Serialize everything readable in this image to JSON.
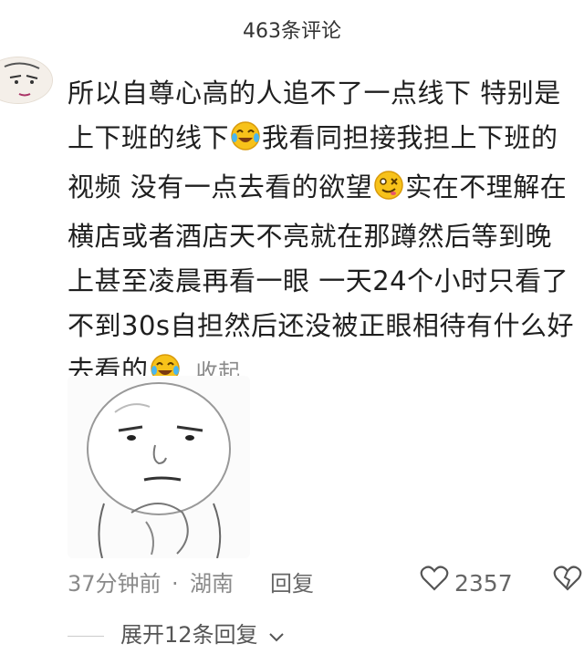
{
  "header": {
    "title": "463条评论"
  },
  "comment": {
    "lines": [
      "所以自尊心高的人追不了一点线下 特别是",
      "上下班的线下",
      "我看同担接我担上下班的",
      "视频 没有一点去看的欲望",
      "实在不理解在",
      "横店或者酒店天不亮就在那蹲然后等到晚",
      "上甚至凌晨再看一眼 一天24个小时只看了",
      "不到30s自担然后还没被正眼相待有什么好",
      "去看的"
    ],
    "collapse_label": "收起",
    "emojis": [
      "crying-laughing-emoji",
      "drooling-emoji",
      "crying-laughing-emoji"
    ]
  },
  "meta": {
    "time": "37分钟前",
    "separator": "·",
    "location": "湖南",
    "reply_label": "回复",
    "like_count": "2357"
  },
  "expand": {
    "label": "展开12条回复"
  },
  "icons": {
    "like": "heart-outline-icon",
    "dislike": "broken-heart-icon",
    "expand": "chevron-down-icon"
  },
  "colors": {
    "text": "#1f1f1f",
    "muted": "#8a8a8a",
    "emoji_yellow": "#f7c21a"
  }
}
